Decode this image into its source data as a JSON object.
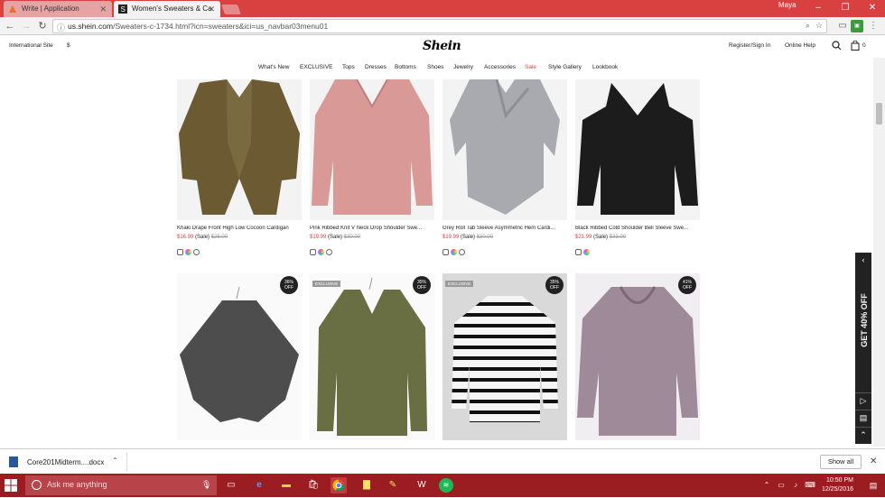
{
  "browser": {
    "tabs": [
      {
        "title": "Write | Application"
      },
      {
        "title": "Women's Sweaters & Ca"
      }
    ],
    "profile": "Maya",
    "url_domain": "us.shein.com",
    "url_path": "/Sweaters-c-1734.html?icn=sweaters&ici=us_navbar03menu01"
  },
  "site": {
    "international": "International Site",
    "currency": "$",
    "logo": "Shein",
    "register": "Register/Sign In",
    "online_help": "Online Help",
    "bag_count": "0",
    "nav": [
      "What's New",
      "EXCLUSIVE",
      "Tops",
      "Dresses",
      "Bottoms",
      "Shoes",
      "Jewelry",
      "Accessories",
      "Sale",
      "Style Gallery",
      "Lookbook"
    ]
  },
  "products_row1": [
    {
      "name": "Khaki Drape Front High Low Cocoon Cardigan",
      "price": "$16.99",
      "sale_tag": "(Sale)",
      "old": "$28.00"
    },
    {
      "name": "Pink Ribbed Knit V Neck Drop Shoulder Swe...",
      "price": "$19.99",
      "sale_tag": "(Sale)",
      "old": "$30.00"
    },
    {
      "name": "Grey Roll Tab Sleeve Asymmetric Hem Cardi...",
      "price": "$19.99",
      "sale_tag": "(Sale)",
      "old": "$30.00"
    },
    {
      "name": "Black Ribbed Cold Shoulder Bell Sleeve Swe...",
      "price": "$21.99",
      "sale_tag": "(Sale)",
      "old": "$33.00"
    }
  ],
  "products_row2": [
    {
      "badge_pct": "36%",
      "badge_off": "OFF",
      "exclusive": ""
    },
    {
      "badge_pct": "35%",
      "badge_off": "OFF",
      "exclusive": "EXCLUSIVE"
    },
    {
      "badge_pct": "35%",
      "badge_off": "OFF",
      "exclusive": "EXCLUSIVE"
    },
    {
      "badge_pct": "41%",
      "badge_off": "OFF",
      "exclusive": ""
    }
  ],
  "side_promo": "GET 40% OFF",
  "download": {
    "filename": "Core201Midterm....docx",
    "show_all": "Show all"
  },
  "taskbar": {
    "search_placeholder": "Ask me anything",
    "time": "10:50 PM",
    "date": "12/25/2016"
  },
  "colors": {
    "brand_sale": "#e8403f",
    "titlebar": "#d94040",
    "taskbar": "#9b1c21"
  }
}
